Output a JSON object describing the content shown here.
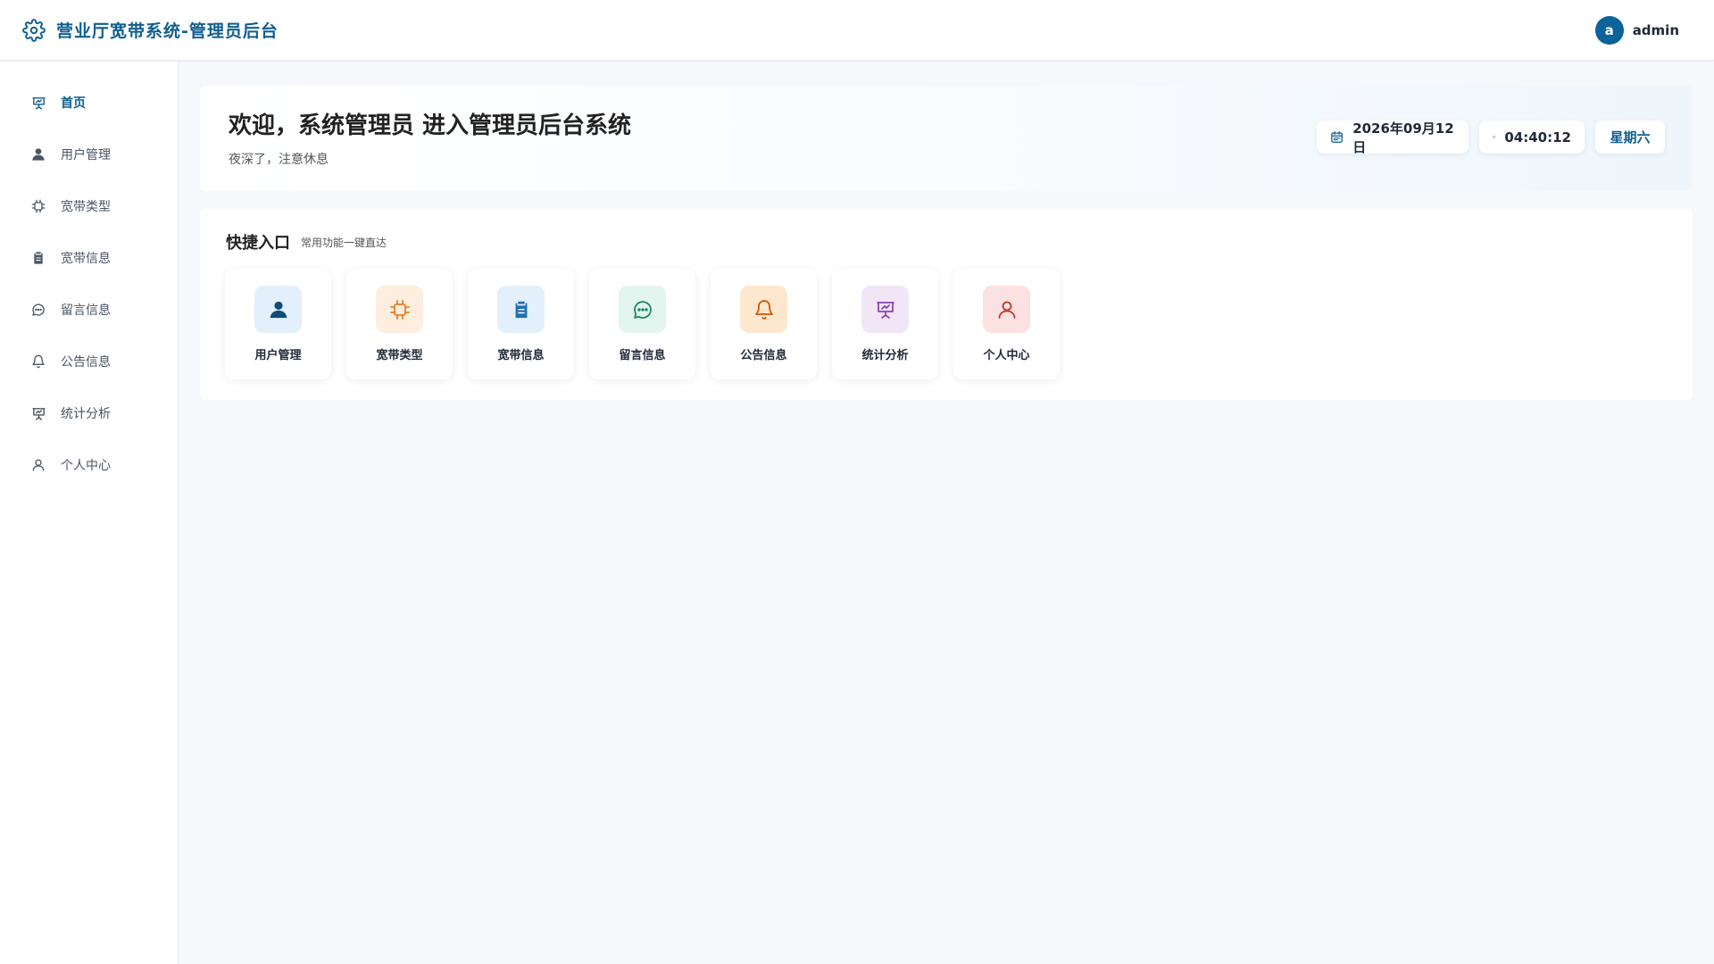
{
  "header": {
    "title": "营业厅宽带系统-管理员后台",
    "avatar_letter": "a",
    "username": "admin"
  },
  "sidebar": {
    "items": [
      {
        "label": "首页",
        "icon": "presentation-icon",
        "active": true
      },
      {
        "label": "用户管理",
        "icon": "user-icon"
      },
      {
        "label": "宽带类型",
        "icon": "chip-icon"
      },
      {
        "label": "宽带信息",
        "icon": "clipboard-icon"
      },
      {
        "label": "留言信息",
        "icon": "message-icon"
      },
      {
        "label": "公告信息",
        "icon": "bell-icon"
      },
      {
        "label": "统计分析",
        "icon": "presentation-icon"
      },
      {
        "label": "个人中心",
        "icon": "user-outline-icon"
      }
    ]
  },
  "welcome": {
    "title": "欢迎，系统管理员 进入管理员后台系统",
    "subtitle": "夜深了，注意休息",
    "date": "2026年09月12日",
    "time": "04:40:12",
    "weekday": "星期六"
  },
  "quick": {
    "title": "快捷入口",
    "subtitle": "常用功能一键直达",
    "cards": [
      {
        "label": "用户管理",
        "icon": "user-icon",
        "bg": "#e3f0fb",
        "color": "#0f4c75"
      },
      {
        "label": "宽带类型",
        "icon": "chip-icon",
        "bg": "#fdeedd",
        "color": "#e67e22"
      },
      {
        "label": "宽带信息",
        "icon": "clipboard-icon",
        "bg": "#e3f0fb",
        "color": "#1f6fb2"
      },
      {
        "label": "留言信息",
        "icon": "message-icon",
        "bg": "#e2f5ee",
        "color": "#1e8a5a"
      },
      {
        "label": "公告信息",
        "icon": "bell-icon",
        "bg": "#fde7cf",
        "color": "#d35400"
      },
      {
        "label": "统计分析",
        "icon": "presentation-icon",
        "bg": "#f1e6f6",
        "color": "#8e44ad"
      },
      {
        "label": "个人中心",
        "icon": "user-outline-icon",
        "bg": "#fbe1e1",
        "color": "#c0392b"
      }
    ]
  },
  "colors": {
    "brand": "#0f5f8f",
    "avatar": "#0a6399",
    "background": "#f6f8fb"
  }
}
